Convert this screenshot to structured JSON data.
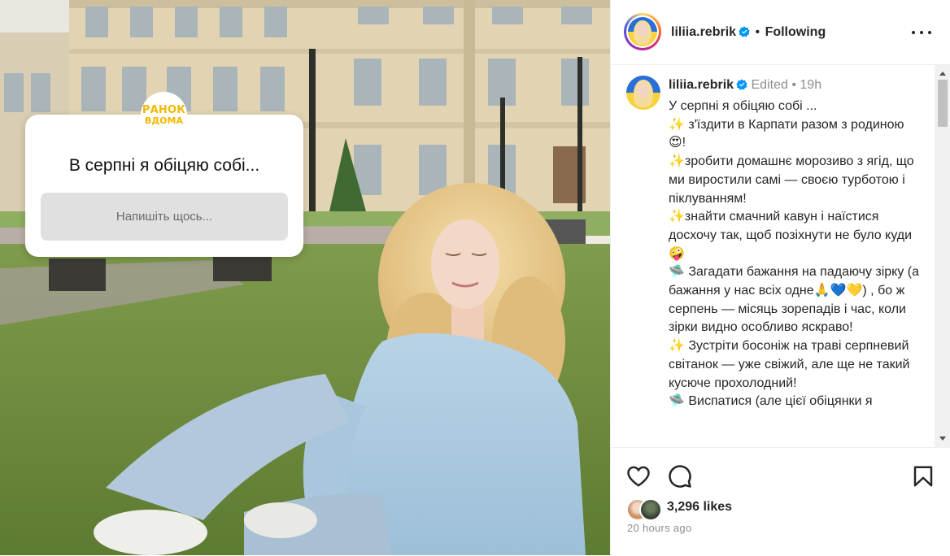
{
  "story": {
    "logo_line1": "РАНОК",
    "logo_line2": "ВДОМА",
    "question": "В серпні я обіцяю собі...",
    "input_placeholder": "Напишіть щось..."
  },
  "header": {
    "username": "liliia.rebrik",
    "separator": "•",
    "follow_label": "Following"
  },
  "caption": {
    "username": "liliia.rebrik",
    "edited_label": "Edited",
    "separator": "•",
    "time": "19h",
    "text": "У серпні я обіцяю собі ...\n✨ з'їздити в Карпати разом з родиною😍!\n✨зробити домашнє морозиво з ягід, що ми виростили самі — своєю турботою і піклуванням!\n✨знайти смачний кавун і наїстися досхочу так, щоб позіхнути не було куди🤪\n🛸 Загадати бажання на падаючу зірку (а бажання у нас всіх одне🙏💙💛) , бо ж серпень — місяць зорепадів і час, коли зірки видно особливо яскраво!\n✨ Зустріти босоніж на траві серпневий світанок — уже свіжий, але ще не такий кусюче прохолодний!\n🛸 Виспатися (але цієї обіцянки я"
  },
  "engagement": {
    "likes": "3,296 likes",
    "time_ago": "20 hours ago"
  },
  "icons": {
    "like": "heart-icon",
    "comment": "comment-icon",
    "save": "bookmark-icon",
    "more": "more-icon",
    "verified": "verified-badge-icon"
  },
  "colors": {
    "verified_blue": "#0095f6",
    "story_accent": "#f5b800",
    "text": "#262626",
    "muted": "#8e8e8e"
  }
}
